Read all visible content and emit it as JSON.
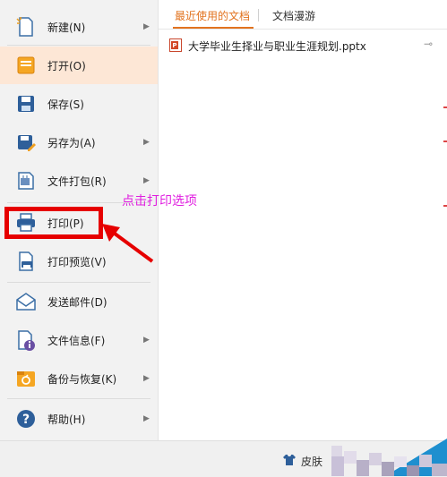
{
  "menu": {
    "items": [
      {
        "label": "新建(N)",
        "icon": "new-document-icon",
        "has_submenu": true
      },
      {
        "label": "打开(O)",
        "icon": "open-folder-icon",
        "has_submenu": false,
        "active": true
      },
      {
        "label": "保存(S)",
        "icon": "save-disk-icon",
        "has_submenu": false
      },
      {
        "label": "另存为(A)",
        "icon": "save-as-icon",
        "has_submenu": true
      },
      {
        "label": "文件打包(R)",
        "icon": "file-package-icon",
        "has_submenu": true
      },
      {
        "label": "打印(P)",
        "icon": "printer-icon",
        "has_submenu": false
      },
      {
        "label": "打印预览(V)",
        "icon": "print-preview-icon",
        "has_submenu": false
      },
      {
        "label": "发送邮件(D)",
        "icon": "send-mail-icon",
        "has_submenu": false
      },
      {
        "label": "文件信息(F)",
        "icon": "file-info-icon",
        "has_submenu": true
      },
      {
        "label": "备份与恢复(K)",
        "icon": "backup-restore-icon",
        "has_submenu": true
      },
      {
        "label": "帮助(H)",
        "icon": "help-icon",
        "has_submenu": true
      }
    ]
  },
  "tabs": {
    "recent": "最近使用的文档",
    "roaming": "文档漫游"
  },
  "recent_files": [
    {
      "name": "大学毕业生择业与职业生涯规划.pptx"
    }
  ],
  "footer": {
    "skin_label": "皮肤"
  },
  "annotation": {
    "text": "点击打印选项"
  },
  "colors": {
    "accent": "#e2731f",
    "active_bg": "#fde7d6",
    "annotation_text": "#e01fe0",
    "highlight": "#e60000"
  }
}
